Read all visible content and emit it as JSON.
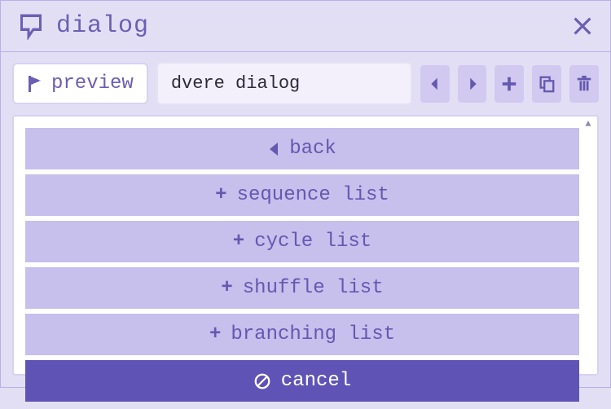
{
  "title": "dialog",
  "toolbar": {
    "preview_label": "preview",
    "name_value": "dvere dialog"
  },
  "list": {
    "back_label": "back",
    "items": [
      {
        "label": "sequence list"
      },
      {
        "label": "cycle list"
      },
      {
        "label": "shuffle list"
      },
      {
        "label": "branching list"
      }
    ],
    "cancel_label": "cancel"
  }
}
